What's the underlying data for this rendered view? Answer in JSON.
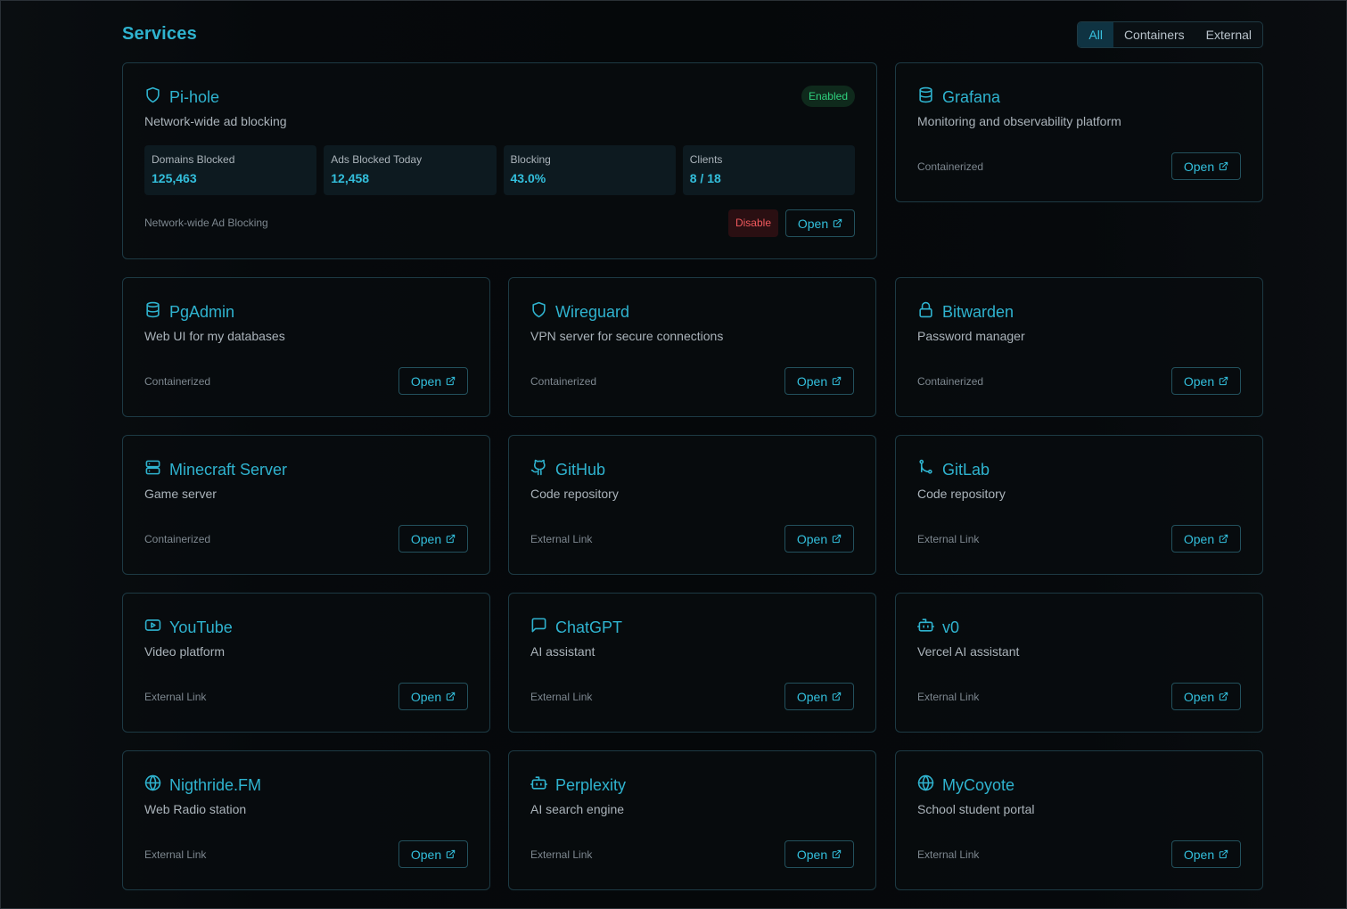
{
  "header": {
    "title": "Services",
    "filters": [
      "All",
      "Containers",
      "External"
    ],
    "active_filter": "All"
  },
  "pihole": {
    "name": "Pi-hole",
    "description": "Network-wide ad blocking",
    "status": "Enabled",
    "icon": "shield-icon",
    "stats": [
      {
        "label": "Domains Blocked",
        "value": "125,463"
      },
      {
        "label": "Ads Blocked Today",
        "value": "12,458"
      },
      {
        "label": "Blocking",
        "value": "43.0%"
      },
      {
        "label": "Clients",
        "value": "8 / 18"
      }
    ],
    "type": "Network-wide Ad Blocking",
    "disable_label": "Disable",
    "open_label": "Open"
  },
  "services": [
    {
      "name": "Grafana",
      "description": "Monitoring and observability platform",
      "type": "Containerized",
      "icon": "database-icon",
      "open_label": "Open"
    },
    {
      "name": "PgAdmin",
      "description": "Web UI for my databases",
      "type": "Containerized",
      "icon": "database-icon",
      "open_label": "Open"
    },
    {
      "name": "Wireguard",
      "description": "VPN server for secure connections",
      "type": "Containerized",
      "icon": "shield-icon",
      "open_label": "Open"
    },
    {
      "name": "Bitwarden",
      "description": "Password manager",
      "type": "Containerized",
      "icon": "lock-icon",
      "open_label": "Open"
    },
    {
      "name": "Minecraft Server",
      "description": "Game server",
      "type": "Containerized",
      "icon": "server-icon",
      "open_label": "Open"
    },
    {
      "name": "GitHub",
      "description": "Code repository",
      "type": "External Link",
      "icon": "github-icon",
      "open_label": "Open"
    },
    {
      "name": "GitLab",
      "description": "Code repository",
      "type": "External Link",
      "icon": "git-branch-icon",
      "open_label": "Open"
    },
    {
      "name": "YouTube",
      "description": "Video platform",
      "type": "External Link",
      "icon": "youtube-icon",
      "open_label": "Open"
    },
    {
      "name": "ChatGPT",
      "description": "AI assistant",
      "type": "External Link",
      "icon": "chat-icon",
      "open_label": "Open"
    },
    {
      "name": "v0",
      "description": "Vercel AI assistant",
      "type": "External Link",
      "icon": "bot-icon",
      "open_label": "Open"
    },
    {
      "name": "Nigthride.FM",
      "description": "Web Radio station",
      "type": "External Link",
      "icon": "globe-icon",
      "open_label": "Open"
    },
    {
      "name": "Perplexity",
      "description": "AI search engine",
      "type": "External Link",
      "icon": "bot-icon",
      "open_label": "Open"
    },
    {
      "name": "MyCoyote",
      "description": "School student portal",
      "type": "External Link",
      "icon": "globe-icon",
      "open_label": "Open"
    }
  ]
}
